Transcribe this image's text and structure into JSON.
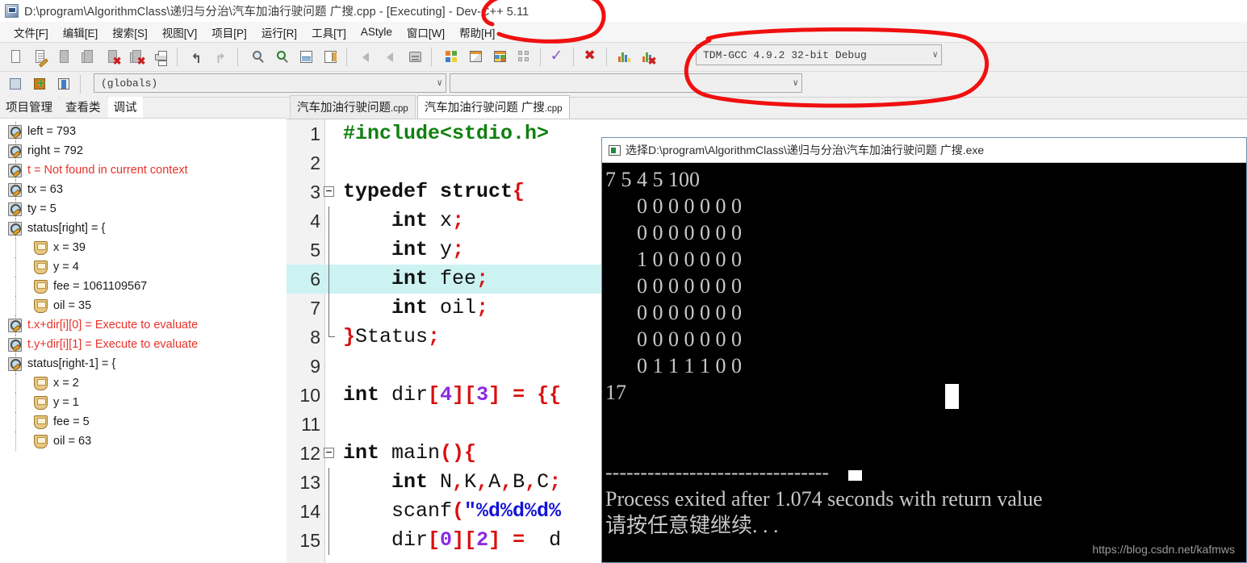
{
  "window": {
    "title": "D:\\program\\AlgorithmClass\\递归与分治\\汽车加油行驶问题 广搜.cpp - [Executing] - Dev-C++ 5.11",
    "app_icon": "devcpp-icon"
  },
  "menu": {
    "items": [
      {
        "label": "文件[F]"
      },
      {
        "label": "编辑[E]"
      },
      {
        "label": "搜索[S]"
      },
      {
        "label": "视图[V]"
      },
      {
        "label": "项目[P]"
      },
      {
        "label": "运行[R]"
      },
      {
        "label": "工具[T]"
      },
      {
        "label": "AStyle"
      },
      {
        "label": "窗口[W]"
      },
      {
        "label": "帮助[H]"
      }
    ]
  },
  "toolbar": {
    "compiler_combo": {
      "value": "TDM-GCC 4.9.2 32-bit Debug",
      "caret": "∨"
    },
    "scope_combo": {
      "value": "(globals)",
      "caret": "∨"
    },
    "member_combo": {
      "value": "",
      "caret": "∨"
    },
    "buttons": [
      {
        "name": "new-file-button"
      },
      {
        "name": "open-file-button"
      },
      {
        "name": "save-file-button"
      },
      {
        "name": "save-all-button"
      },
      {
        "name": "close-file-button"
      },
      {
        "name": "close-all-button"
      },
      {
        "name": "print-button"
      },
      {
        "name": "undo-button"
      },
      {
        "name": "redo-button"
      },
      {
        "name": "find-button"
      },
      {
        "name": "replace-button"
      },
      {
        "name": "goto-line-button"
      },
      {
        "name": "goto-function-button"
      },
      {
        "name": "back-button"
      },
      {
        "name": "forward-button"
      },
      {
        "name": "toggle-bookmark-button"
      },
      {
        "name": "compile-button"
      },
      {
        "name": "run-button"
      },
      {
        "name": "compile-run-button"
      },
      {
        "name": "rebuild-all-button"
      },
      {
        "name": "syntax-check-button"
      },
      {
        "name": "stop-execution-button"
      },
      {
        "name": "profile-button"
      },
      {
        "name": "delete-profile-button"
      }
    ],
    "nav_buttons": [
      {
        "name": "add-watch-button"
      },
      {
        "name": "insert-button"
      },
      {
        "name": "toggle-panel-button"
      }
    ]
  },
  "left_panel": {
    "tabs": [
      {
        "label": "项目管理",
        "active": false
      },
      {
        "label": "查看类",
        "active": false
      },
      {
        "label": "调试",
        "active": true
      }
    ],
    "watch_tree": [
      {
        "text": "left = 793",
        "icon": "watch-icon",
        "level": 0,
        "red": false,
        "expander": ""
      },
      {
        "text": "right = 792",
        "icon": "watch-icon",
        "level": 0,
        "red": false,
        "expander": ""
      },
      {
        "text": "t = Not found in current context",
        "icon": "watch-icon",
        "level": 0,
        "red": true,
        "expander": ""
      },
      {
        "text": "tx = 63",
        "icon": "watch-icon",
        "level": 0,
        "red": false,
        "expander": ""
      },
      {
        "text": "ty = 5",
        "icon": "watch-icon",
        "level": 0,
        "red": false,
        "expander": ""
      },
      {
        "text": "status[right] = {",
        "icon": "watch-icon",
        "level": 0,
        "red": false,
        "expander": "−"
      },
      {
        "text": "x = 39",
        "icon": "member-icon",
        "level": 1,
        "red": false,
        "expander": ""
      },
      {
        "text": "y = 4",
        "icon": "member-icon",
        "level": 1,
        "red": false,
        "expander": ""
      },
      {
        "text": "fee = 1061109567",
        "icon": "member-icon",
        "level": 1,
        "red": false,
        "expander": ""
      },
      {
        "text": "oil = 35",
        "icon": "member-icon",
        "level": 1,
        "red": false,
        "expander": ""
      },
      {
        "text": "t.x+dir[i][0] = Execute to evaluate",
        "icon": "watch-icon",
        "level": 0,
        "red": true,
        "expander": ""
      },
      {
        "text": "t.y+dir[i][1] = Execute to evaluate",
        "icon": "watch-icon",
        "level": 0,
        "red": true,
        "expander": ""
      },
      {
        "text": "status[right-1] = {",
        "icon": "watch-icon",
        "level": 0,
        "red": false,
        "expander": "−"
      },
      {
        "text": "x = 2",
        "icon": "member-icon",
        "level": 1,
        "red": false,
        "expander": ""
      },
      {
        "text": "y = 1",
        "icon": "member-icon",
        "level": 1,
        "red": false,
        "expander": ""
      },
      {
        "text": "fee = 5",
        "icon": "member-icon",
        "level": 1,
        "red": false,
        "expander": ""
      },
      {
        "text": "oil = 63",
        "icon": "member-icon",
        "level": 1,
        "red": false,
        "expander": ""
      }
    ]
  },
  "editor": {
    "tabs": [
      {
        "name": "汽车加油行驶问题",
        "ext": ".cpp",
        "active": false
      },
      {
        "name": "汽车加油行驶问题 广搜",
        "ext": ".cpp",
        "active": true
      }
    ],
    "highlight_line": 6,
    "lines": [
      {
        "no": "1",
        "fold": "",
        "html": "<span class=\"pp\">#include&lt;stdio.h&gt;</span>"
      },
      {
        "no": "2",
        "fold": "",
        "html": ""
      },
      {
        "no": "3",
        "fold": "−",
        "html": "<span class=\"kw\">typedef struct</span><span class=\"pun\">{</span>"
      },
      {
        "no": "4",
        "fold": "|",
        "html": "    <span class=\"kw\">int</span> <span class=\"id\">x</span><span class=\"pun\">;</span>"
      },
      {
        "no": "5",
        "fold": "|",
        "html": "    <span class=\"kw\">int</span> <span class=\"id\">y</span><span class=\"pun\">;</span>"
      },
      {
        "no": "6",
        "fold": "|",
        "html": "    <span class=\"kw\">int</span> <span class=\"id\">fee</span><span class=\"pun\">;</span>"
      },
      {
        "no": "7",
        "fold": "|",
        "html": "    <span class=\"kw\">int</span> <span class=\"id\">oil</span><span class=\"pun\">;</span>"
      },
      {
        "no": "8",
        "fold": "L",
        "html": "<span class=\"pun\">}</span><span class=\"id\">Status</span><span class=\"pun\">;</span>"
      },
      {
        "no": "9",
        "fold": "",
        "html": ""
      },
      {
        "no": "10",
        "fold": "",
        "html": "<span class=\"kw\">int</span> <span class=\"id\">dir</span><span class=\"pun\">[</span><span class=\"num\">4</span><span class=\"pun\">][</span><span class=\"num\">3</span><span class=\"pun\">]</span> <span class=\"pun\">=</span> <span class=\"pun\">{{</span>"
      },
      {
        "no": "11",
        "fold": "",
        "html": ""
      },
      {
        "no": "12",
        "fold": "−",
        "html": "<span class=\"kw\">int</span> <span class=\"id\">main</span><span class=\"pun\">(){</span>"
      },
      {
        "no": "13",
        "fold": "|",
        "html": "    <span class=\"kw\">int</span> <span class=\"id\">N</span><span class=\"pun\">,</span><span class=\"id\">K</span><span class=\"pun\">,</span><span class=\"id\">A</span><span class=\"pun\">,</span><span class=\"id\">B</span><span class=\"pun\">,</span><span class=\"id\">C</span><span class=\"pun\">;</span>"
      },
      {
        "no": "14",
        "fold": "|",
        "html": "    <span class=\"id\">scanf</span><span class=\"pun\">(</span><span class=\"str\">\"%d%d%d%</span>"
      },
      {
        "no": "15",
        "fold": "|",
        "html": "    <span class=\"id\">dir</span><span class=\"pun\">[</span><span class=\"num\">0</span><span class=\"pun\">][</span><span class=\"num\">2</span><span class=\"pun\">]</span> <span class=\"pun\">=</span>  <span class=\"id\">d</span>"
      }
    ]
  },
  "console": {
    "title": "选择D:\\program\\AlgorithmClass\\递归与分治\\汽车加油行驶问题 广搜.exe",
    "icon": "console-icon",
    "output": "7 5 4 5 100\n      0 0 0 0 0 0 0\n      0 0 0 0 0 0 0\n      1 0 0 0 0 0 0\n      0 0 0 0 0 0 0\n      0 0 0 0 0 0 0\n      0 0 0 0 0 0 0\n      0 1 1 1 1 0 0\n17\n\n\n--------------------------------\nProcess exited after 1.074 seconds with return value\n请按任意键继续. . .",
    "watermark": "https://blog.csdn.net/kafmws"
  },
  "annotations": {
    "color": "#f01010",
    "shapes": [
      {
        "name": "title-version-circle"
      },
      {
        "name": "compiler-combo-circle"
      }
    ]
  }
}
